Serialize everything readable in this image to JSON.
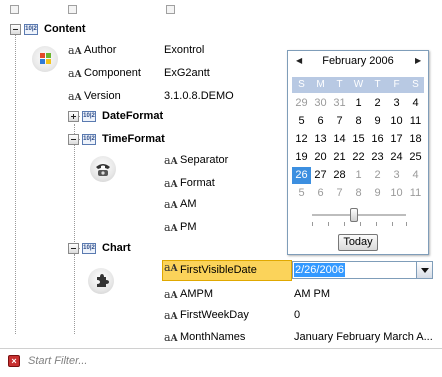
{
  "tree": {
    "rows": {
      "content": {
        "label": "Content"
      },
      "author": {
        "label": "Author",
        "value": "Exontrol"
      },
      "component": {
        "label": "Component",
        "value": "ExG2antt"
      },
      "version": {
        "label": "Version",
        "value": "3.1.0.8.DEMO"
      },
      "dateformat": {
        "label": "DateFormat"
      },
      "timeformat": {
        "label": "TimeFormat"
      },
      "separator": {
        "label": "Separator"
      },
      "format": {
        "label": "Format"
      },
      "am": {
        "label": "AM"
      },
      "pm": {
        "label": "PM"
      },
      "chart": {
        "label": "Chart"
      },
      "firstvisibledate": {
        "label": "FirstVisibleDate",
        "value": "2/26/2006"
      },
      "ampm": {
        "label": "AMPM",
        "value": "AM PM"
      },
      "firstweekday": {
        "label": "FirstWeekDay",
        "value": "0"
      },
      "monthnames": {
        "label": "MonthNames",
        "value": "January February March A..."
      }
    },
    "aa_glyph": "a",
    "aa_glyph_big": "A",
    "group_glyph": "10|2"
  },
  "calendar": {
    "title": "February 2006",
    "prev_arrow": "◀",
    "next_arrow": "▶",
    "weekdays": [
      "S",
      "M",
      "T",
      "W",
      "T",
      "F",
      "S"
    ],
    "weeks": [
      [
        "29",
        "30",
        "31",
        "1",
        "2",
        "3",
        "4"
      ],
      [
        "5",
        "6",
        "7",
        "8",
        "9",
        "10",
        "11"
      ],
      [
        "12",
        "13",
        "14",
        "15",
        "16",
        "17",
        "18"
      ],
      [
        "19",
        "20",
        "21",
        "22",
        "23",
        "24",
        "25"
      ],
      [
        "26",
        "27",
        "28",
        "1",
        "2",
        "3",
        "4"
      ],
      [
        "5",
        "6",
        "7",
        "8",
        "9",
        "10",
        "11"
      ]
    ],
    "dim_cells": [
      [
        0,
        0
      ],
      [
        0,
        1
      ],
      [
        0,
        2
      ],
      [
        4,
        3
      ],
      [
        4,
        4
      ],
      [
        4,
        5
      ],
      [
        4,
        6
      ],
      [
        5,
        0
      ],
      [
        5,
        1
      ],
      [
        5,
        2
      ],
      [
        5,
        3
      ],
      [
        5,
        4
      ],
      [
        5,
        5
      ],
      [
        5,
        6
      ]
    ],
    "selected_cell": [
      4,
      0
    ],
    "today_label": "Today",
    "slider_value": 0.45
  },
  "filter": {
    "close_glyph": "×",
    "placeholder": "Start Filter..."
  },
  "colors": {
    "selection": "#3c8fe0",
    "edit_row_bg": "#fbd35a",
    "weekday_bar": "#b8c9e3"
  }
}
